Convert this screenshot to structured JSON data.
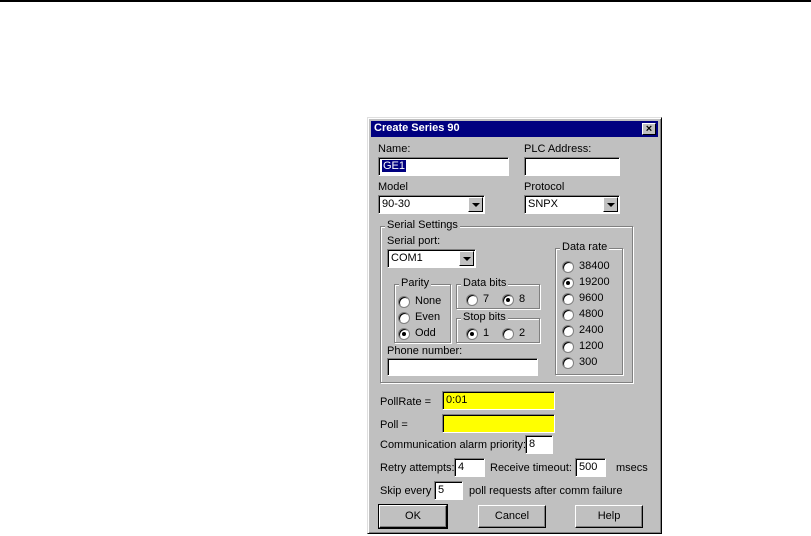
{
  "dialog": {
    "title": "Create Series 90",
    "close_glyph": "×",
    "name_label": "Name:",
    "name_value": "GE1",
    "plc_address_label": "PLC Address:",
    "plc_address_value": "",
    "model_label": "Model",
    "model_value": "90-30",
    "protocol_label": "Protocol",
    "protocol_value": "SNPX",
    "serial": {
      "group_label": "Serial Settings",
      "port_label": "Serial port:",
      "port_value": "COM1",
      "parity": {
        "label": "Parity",
        "options": [
          "None",
          "Even",
          "Odd"
        ],
        "selected": "Odd"
      },
      "data_bits": {
        "label": "Data bits",
        "options": [
          "7",
          "8"
        ],
        "selected": "8"
      },
      "stop_bits": {
        "label": "Stop bits",
        "options": [
          "1",
          "2"
        ],
        "selected": "1"
      },
      "data_rate": {
        "label": "Data rate",
        "options": [
          "38400",
          "19200",
          "9600",
          "4800",
          "2400",
          "1200",
          "300"
        ],
        "selected": "19200"
      },
      "phone_label": "Phone number:",
      "phone_value": ""
    },
    "poll_rate_label": "PollRate =",
    "poll_rate_value": "0:01",
    "poll_label": "Poll =",
    "poll_value": "",
    "alarm_priority_label": "Communication alarm priority:",
    "alarm_priority_value": "8",
    "retry_label": "Retry attempts:",
    "retry_value": "4",
    "receive_timeout_label": "Receive timeout:",
    "receive_timeout_value": "500",
    "msecs_label": "msecs",
    "skip_every_label": "Skip every",
    "skip_value": "5",
    "skip_suffix_label": "poll requests after comm failure",
    "ok_label": "OK",
    "cancel_label": "Cancel",
    "help_label": "Help"
  },
  "colors": {
    "dialog_bg": "#c0c0c0",
    "titlebar": "#000080",
    "highlight_field": "#ffff00"
  }
}
